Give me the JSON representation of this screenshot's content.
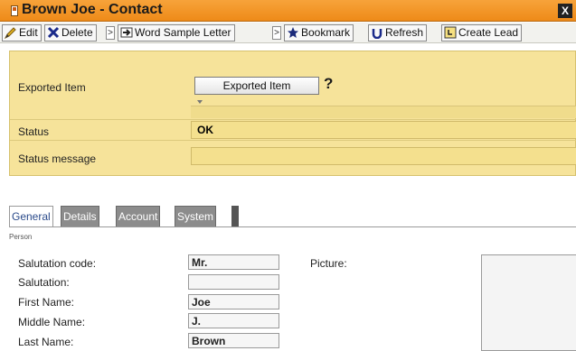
{
  "window": {
    "title": "Brown Joe - Contact",
    "close_glyph": "X"
  },
  "toolbar": {
    "edit": "Edit",
    "delete": "Delete",
    "sep": ">",
    "word_sample_letter": "Word Sample Letter",
    "bookmark": "Bookmark",
    "refresh": "Refresh",
    "create_lead": "Create Lead"
  },
  "export_panel": {
    "exported_item_label": "Exported Item",
    "exported_item_button": "Exported Item",
    "help_glyph": "?",
    "status_label": "Status",
    "status_value": "OK",
    "status_message_label": "Status message",
    "status_message_value": ""
  },
  "tabs": [
    "General",
    "Details",
    "Account",
    "System"
  ],
  "form": {
    "group": "Person",
    "picture_label": "Picture:",
    "fields": [
      {
        "label": "Salutation code:",
        "value": "Mr."
      },
      {
        "label": "Salutation:",
        "value": ""
      },
      {
        "label": "First Name:",
        "value": "Joe"
      },
      {
        "label": "Middle Name:",
        "value": "J."
      },
      {
        "label": "Last Name:",
        "value": "Brown"
      }
    ]
  },
  "colors": {
    "title_bar": "#ee8a18",
    "panel": "#f6e39a",
    "active_tab_text": "#2a4a8a"
  }
}
